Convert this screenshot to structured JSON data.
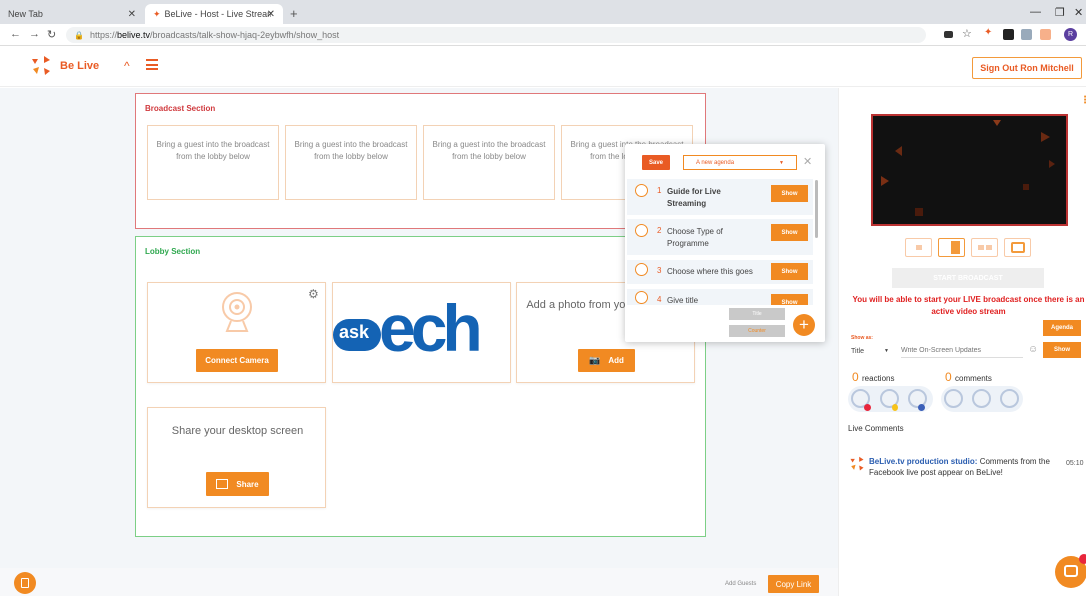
{
  "browser": {
    "tabs": [
      {
        "label": "New Tab"
      },
      {
        "label": "BeLive - Host - Live Stream Guid"
      }
    ],
    "url_prefix": "https://",
    "url_host": "belive.tv",
    "url_path": "/broadcasts/talk-show-hjaq-2eybwfh/show_host",
    "profile_initial": "R"
  },
  "app": {
    "brand": "Be Live",
    "sign_out_label": "Sign Out Ron Mitchell"
  },
  "broadcast": {
    "title": "Broadcast Section",
    "slots": [
      "Bring a guest into the broadcast from the lobby below",
      "Bring a guest into the broadcast from the lobby below",
      "Bring a guest into the broadcast from the lobby below",
      "Bring a guest into the broadcast from the lobby below"
    ]
  },
  "lobby": {
    "title": "Lobby Section",
    "connect_camera_label": "Connect Camera",
    "brand_logo_text": "askQech",
    "photo_text": "Add a photo from your albums",
    "add_label": "Add",
    "desktop_text": "Share your desktop screen",
    "share_label": "Share"
  },
  "agenda": {
    "save_label": "Save",
    "selected_agenda": "A new agenda",
    "items": [
      {
        "num": "1",
        "label": "Guide for Live Streaming",
        "show": "Show"
      },
      {
        "num": "2",
        "label": "Choose Type of Programme",
        "show": "Show"
      },
      {
        "num": "3",
        "label": "Choose where this goes",
        "show": "Show"
      },
      {
        "num": "4",
        "label": "Give title",
        "show": "Show"
      }
    ],
    "title_btn": "Title",
    "counter_btn": "Counter"
  },
  "right": {
    "start_label": "START BROADCAST",
    "warning": "You will be able to start your LIVE broadcast once there is an active video stream",
    "agenda_label": "Agenda",
    "show_as_label": "Show as:",
    "show_as_value": "Title",
    "updates_placeholder": "Write On-Screen Updates",
    "show_label": "Show",
    "reactions_count": "0",
    "reactions_label": "reactions",
    "comments_count": "0",
    "comments_label": "comments",
    "live_comments_title": "Live Comments",
    "comment_author": "BeLive.tv production studio:",
    "comment_text": "Comments from the Facebook live post appear on BeLive!",
    "comment_time": "05:10"
  },
  "footer": {
    "add_guests_label": "Add Guests",
    "copy_link_label": "Copy Link"
  },
  "colors": {
    "accent": "#f18a22",
    "brand": "#e95b24",
    "warning": "#e02020"
  }
}
